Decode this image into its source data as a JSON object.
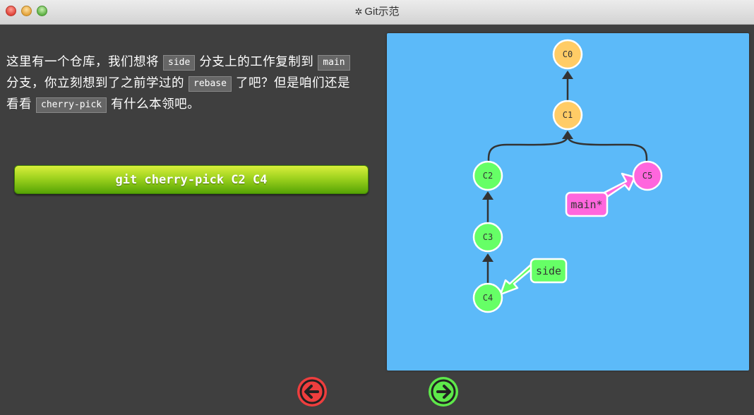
{
  "window": {
    "title": "Git示范",
    "icon": "gear-icon"
  },
  "description": {
    "line1_a": "这里有一个仓库，我们想将",
    "code_side": "side",
    "line1_b": "分支上的工作复制到",
    "code_main": "main",
    "line2_a": "分支，你立刻想到了之前学过的",
    "code_rebase": "rebase",
    "line2_b": "了吧？但是咱们还是",
    "line3_a": "看看",
    "code_cherry": "cherry-pick",
    "line3_b": "有什么本领吧。"
  },
  "command_button": {
    "label": "git cherry-pick C2 C4"
  },
  "graph": {
    "commits": {
      "c0": "C0",
      "c1": "C1",
      "c2": "C2",
      "c3": "C3",
      "c4": "C4",
      "c5": "C5"
    },
    "branches": {
      "side": "side",
      "main": "main*"
    },
    "colors": {
      "background": "#5cbaf9",
      "main_branch": "#ff66dd",
      "side_branch": "#66ff66",
      "root_commits": "#ffcc66"
    }
  },
  "navigation": {
    "back_icon": "arrow-left-icon",
    "forward_icon": "arrow-right-icon"
  }
}
